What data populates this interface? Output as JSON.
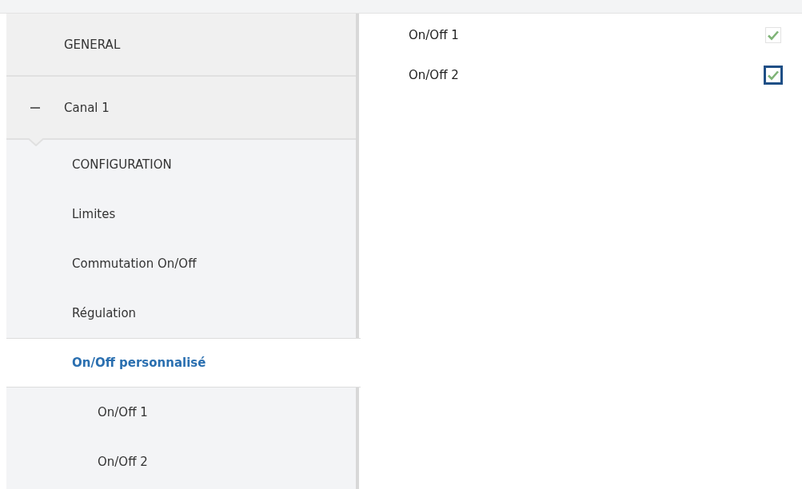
{
  "sidebar": {
    "items": [
      {
        "label": "GENERAL",
        "selected": false
      },
      {
        "label": "Canal 1",
        "selected": false,
        "expanded": true,
        "children": [
          {
            "label": "CONFIGURATION",
            "selected": false
          },
          {
            "label": "Limites",
            "selected": false
          },
          {
            "label": "Commutation On/Off",
            "selected": false
          },
          {
            "label": "Régulation",
            "selected": false
          },
          {
            "label": "On/Off personnalisé",
            "selected": true,
            "children": [
              {
                "label": "On/Off 1",
                "selected": false
              },
              {
                "label": "On/Off 2",
                "selected": false
              }
            ]
          }
        ]
      }
    ]
  },
  "options": [
    {
      "label": "On/Off 1",
      "checked": true,
      "focused": false
    },
    {
      "label": "On/Off 2",
      "checked": true,
      "focused": true
    }
  ]
}
